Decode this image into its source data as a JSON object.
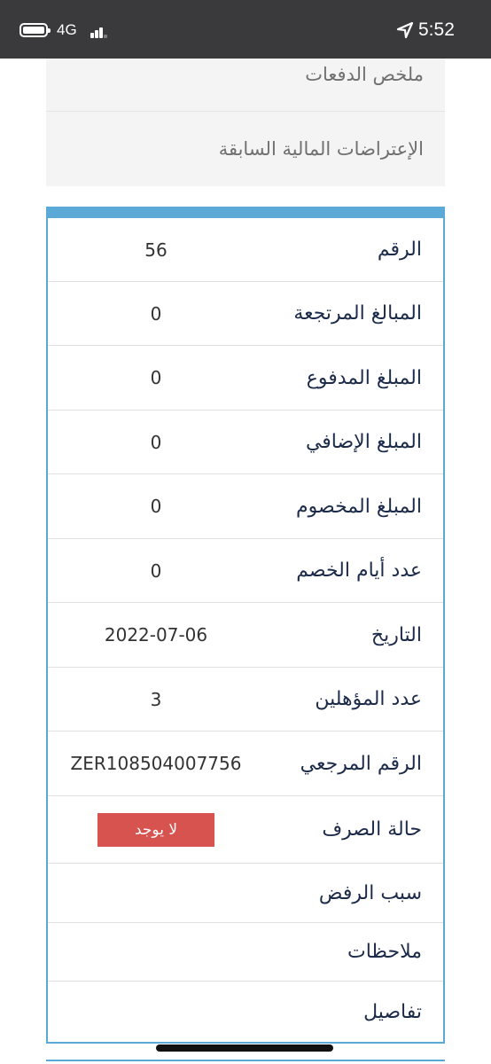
{
  "status_bar": {
    "network": "4G",
    "time": "5:52"
  },
  "menu": {
    "items": [
      {
        "label": "ملخص الدفعات"
      },
      {
        "label": "الإعتراضات المالية السابقة"
      }
    ]
  },
  "details": {
    "rows": [
      {
        "label": "الرقم",
        "value": "56"
      },
      {
        "label": "المبالغ المرتجعة",
        "value": "0"
      },
      {
        "label": "المبلغ المدفوع",
        "value": "0"
      },
      {
        "label": "المبلغ الإضافي",
        "value": "0"
      },
      {
        "label": "المبلغ المخصوم",
        "value": "0"
      },
      {
        "label": "عدد أيام الخصم",
        "value": "0"
      },
      {
        "label": "التاريخ",
        "value": "2022-07-06"
      },
      {
        "label": "عدد المؤهلين",
        "value": "3"
      },
      {
        "label": "الرقم المرجعي",
        "value": "ZER108504007756"
      },
      {
        "label": "حالة الصرف",
        "badge": "لا يوجد"
      },
      {
        "label": "سبب الرفض",
        "value": ""
      },
      {
        "label": "ملاحظات",
        "value": ""
      },
      {
        "label": "تفاصيل",
        "value": ""
      }
    ]
  },
  "colors": {
    "status_bar_bg": "#3a3a3c",
    "accent": "#5aa9d6",
    "label_text": "#1c2b4a",
    "badge_bg": "#d6534f",
    "menu_bg": "#f4f4f4"
  },
  "icons": [
    "battery-icon",
    "signal-icon",
    "location-arrow-icon"
  ]
}
